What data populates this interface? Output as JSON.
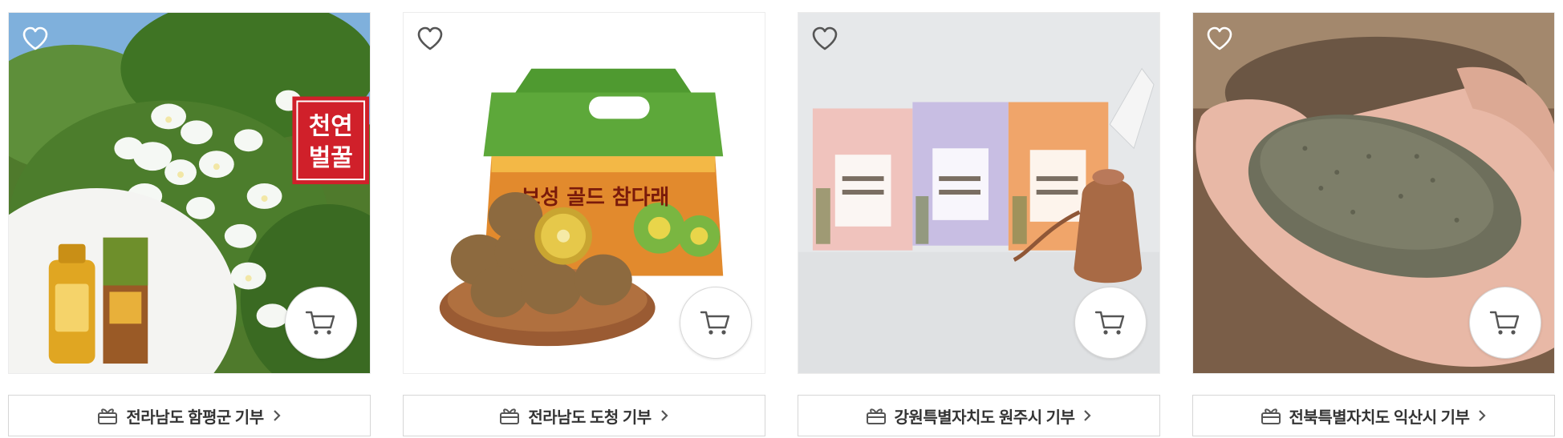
{
  "products": [
    {
      "badge_text": "천연\n벌꿀",
      "badge_line1": "천연",
      "badge_line2": "벌꿀",
      "donate_label": "전라남도 함평군 기부"
    },
    {
      "box_text": "보성 골드 참다래",
      "donate_label": "전라남도 도청 기부"
    },
    {
      "donate_label": "강원특별자치도 원주시 기부"
    },
    {
      "donate_label": "전북특별자치도 익산시 기부"
    }
  ],
  "icons": {
    "wishlist": "heart-outline-icon",
    "cart": "shopping-cart-icon",
    "donate": "gift-box-icon",
    "arrow": "chevron-right-icon"
  },
  "colors": {
    "border": "#d6d6d6",
    "text": "#333333",
    "icon": "#555555"
  }
}
